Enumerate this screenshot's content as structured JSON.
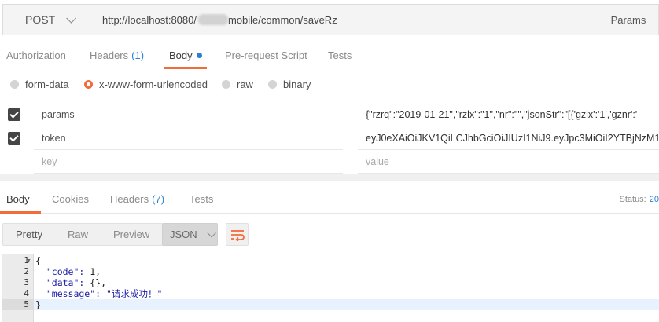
{
  "request": {
    "method": "POST",
    "url_prefix": "http://localhost:8080/",
    "url_suffix": "mobile/common/saveRz",
    "params_label": "Params"
  },
  "request_tabs": [
    {
      "label": "Authorization",
      "count": ""
    },
    {
      "label": "Headers",
      "count": "(1)"
    },
    {
      "label": "Body",
      "count": ""
    },
    {
      "label": "Pre-request Script",
      "count": ""
    },
    {
      "label": "Tests",
      "count": ""
    }
  ],
  "body_types": [
    "form-data",
    "x-www-form-urlencoded",
    "raw",
    "binary"
  ],
  "kv_rows": [
    {
      "key": "params",
      "value": "{\"rzrq\":\"2019-01-21\",\"rzlx\":\"1\",\"nr\":\"\",\"jsonStr\":\"[{'gzlx':'1','gznr':'"
    },
    {
      "key": "token",
      "value": "eyJ0eXAiOiJKV1QiLCJhbGciOiJIUzI1NiJ9.eyJpc3MiOiI2YTBjNzM1M"
    }
  ],
  "kv_placeholder": {
    "key": "key",
    "value": "value"
  },
  "response_tabs": [
    {
      "label": "Body",
      "count": ""
    },
    {
      "label": "Cookies",
      "count": ""
    },
    {
      "label": "Headers",
      "count": "(7)"
    },
    {
      "label": "Tests",
      "count": ""
    }
  ],
  "status": {
    "label": "Status:",
    "code": "20"
  },
  "format_buttons": [
    "Pretty",
    "Raw",
    "Preview"
  ],
  "format_select": "JSON",
  "code": {
    "line_numbers": [
      "1",
      "2",
      "3",
      "4",
      "5"
    ],
    "line1": "{",
    "line2_key": "  \"code\": ",
    "line2_val": "1,",
    "line3_key": "  \"data\": ",
    "line3_val": "{},",
    "line4_key": "  \"message\": ",
    "line4_val": "\"请求成功！\"",
    "line5": "}"
  },
  "colors": {
    "accent": "#f26b3a",
    "link": "#2a7fd4"
  }
}
